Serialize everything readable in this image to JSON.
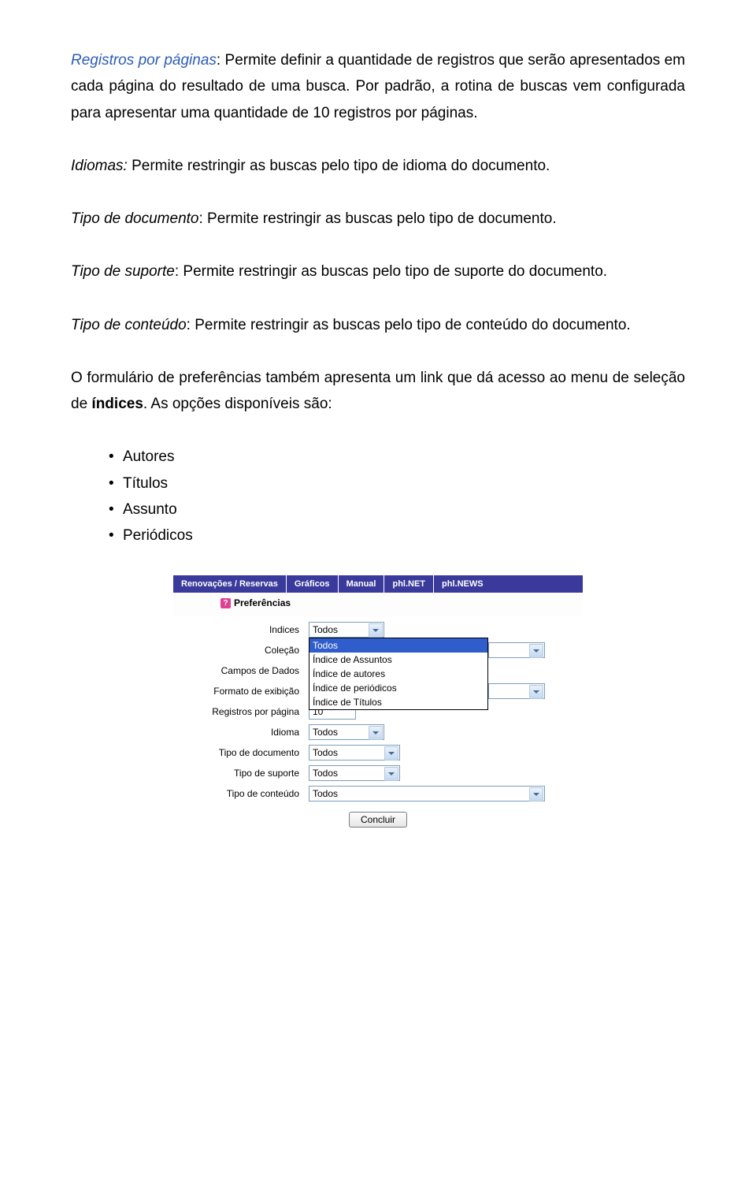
{
  "para1": {
    "term": "Registros por páginas",
    "body": ": Permite definir a quantidade de registros que serão apresentados em cada página do resultado de uma busca. Por padrão, a rotina de buscas vem configurada para apresentar uma quantidade de 10 registros por páginas."
  },
  "para2": {
    "term": "Idiomas:",
    "body": " Permite restringir as buscas pelo tipo de idioma do documento."
  },
  "para3": {
    "term": "Tipo de documento",
    "body": ": Permite restringir as buscas pelo tipo de documento."
  },
  "para4": {
    "term": "Tipo de suporte",
    "body": ": Permite restringir as buscas pelo tipo de suporte do documento."
  },
  "para5": {
    "term": "Tipo de conteúdo",
    "body": ": Permite restringir as buscas pelo tipo de conteúdo do documento."
  },
  "para6": {
    "pre": "O formulário de preferências também apresenta um link que dá acesso ao menu de seleção de ",
    "bold": "índices",
    "post": ". As opções disponíveis são:"
  },
  "bullets": [
    "Autores",
    "Títulos",
    "Assunto",
    "Periódicos"
  ],
  "app": {
    "nav": [
      "Renovações / Reservas",
      "Gráficos",
      "Manual",
      "phl.NET",
      "phl.NEWS"
    ],
    "help_glyph": "?",
    "heading": "Preferências",
    "form": {
      "indices": {
        "label": "Indices",
        "value": "Todos",
        "options": [
          "Todos",
          "Índice de Assuntos",
          "Índice de autores",
          "Índice de periódicos",
          "Índice de Títulos"
        ]
      },
      "colecao": {
        "label": "Coleção"
      },
      "campos": {
        "label": "Campos de Dados"
      },
      "formato": {
        "label": "Formato de exibição"
      },
      "registros": {
        "label": "Registros por página",
        "value": "10"
      },
      "idioma": {
        "label": "Idioma",
        "value": "Todos"
      },
      "tipo_doc": {
        "label": "Tipo de documento",
        "value": "Todos"
      },
      "tipo_sup": {
        "label": "Tipo de suporte",
        "value": "Todos"
      },
      "tipo_con": {
        "label": "Tipo de conteúdo",
        "value": "Todos"
      }
    },
    "submit": "Concluir"
  }
}
